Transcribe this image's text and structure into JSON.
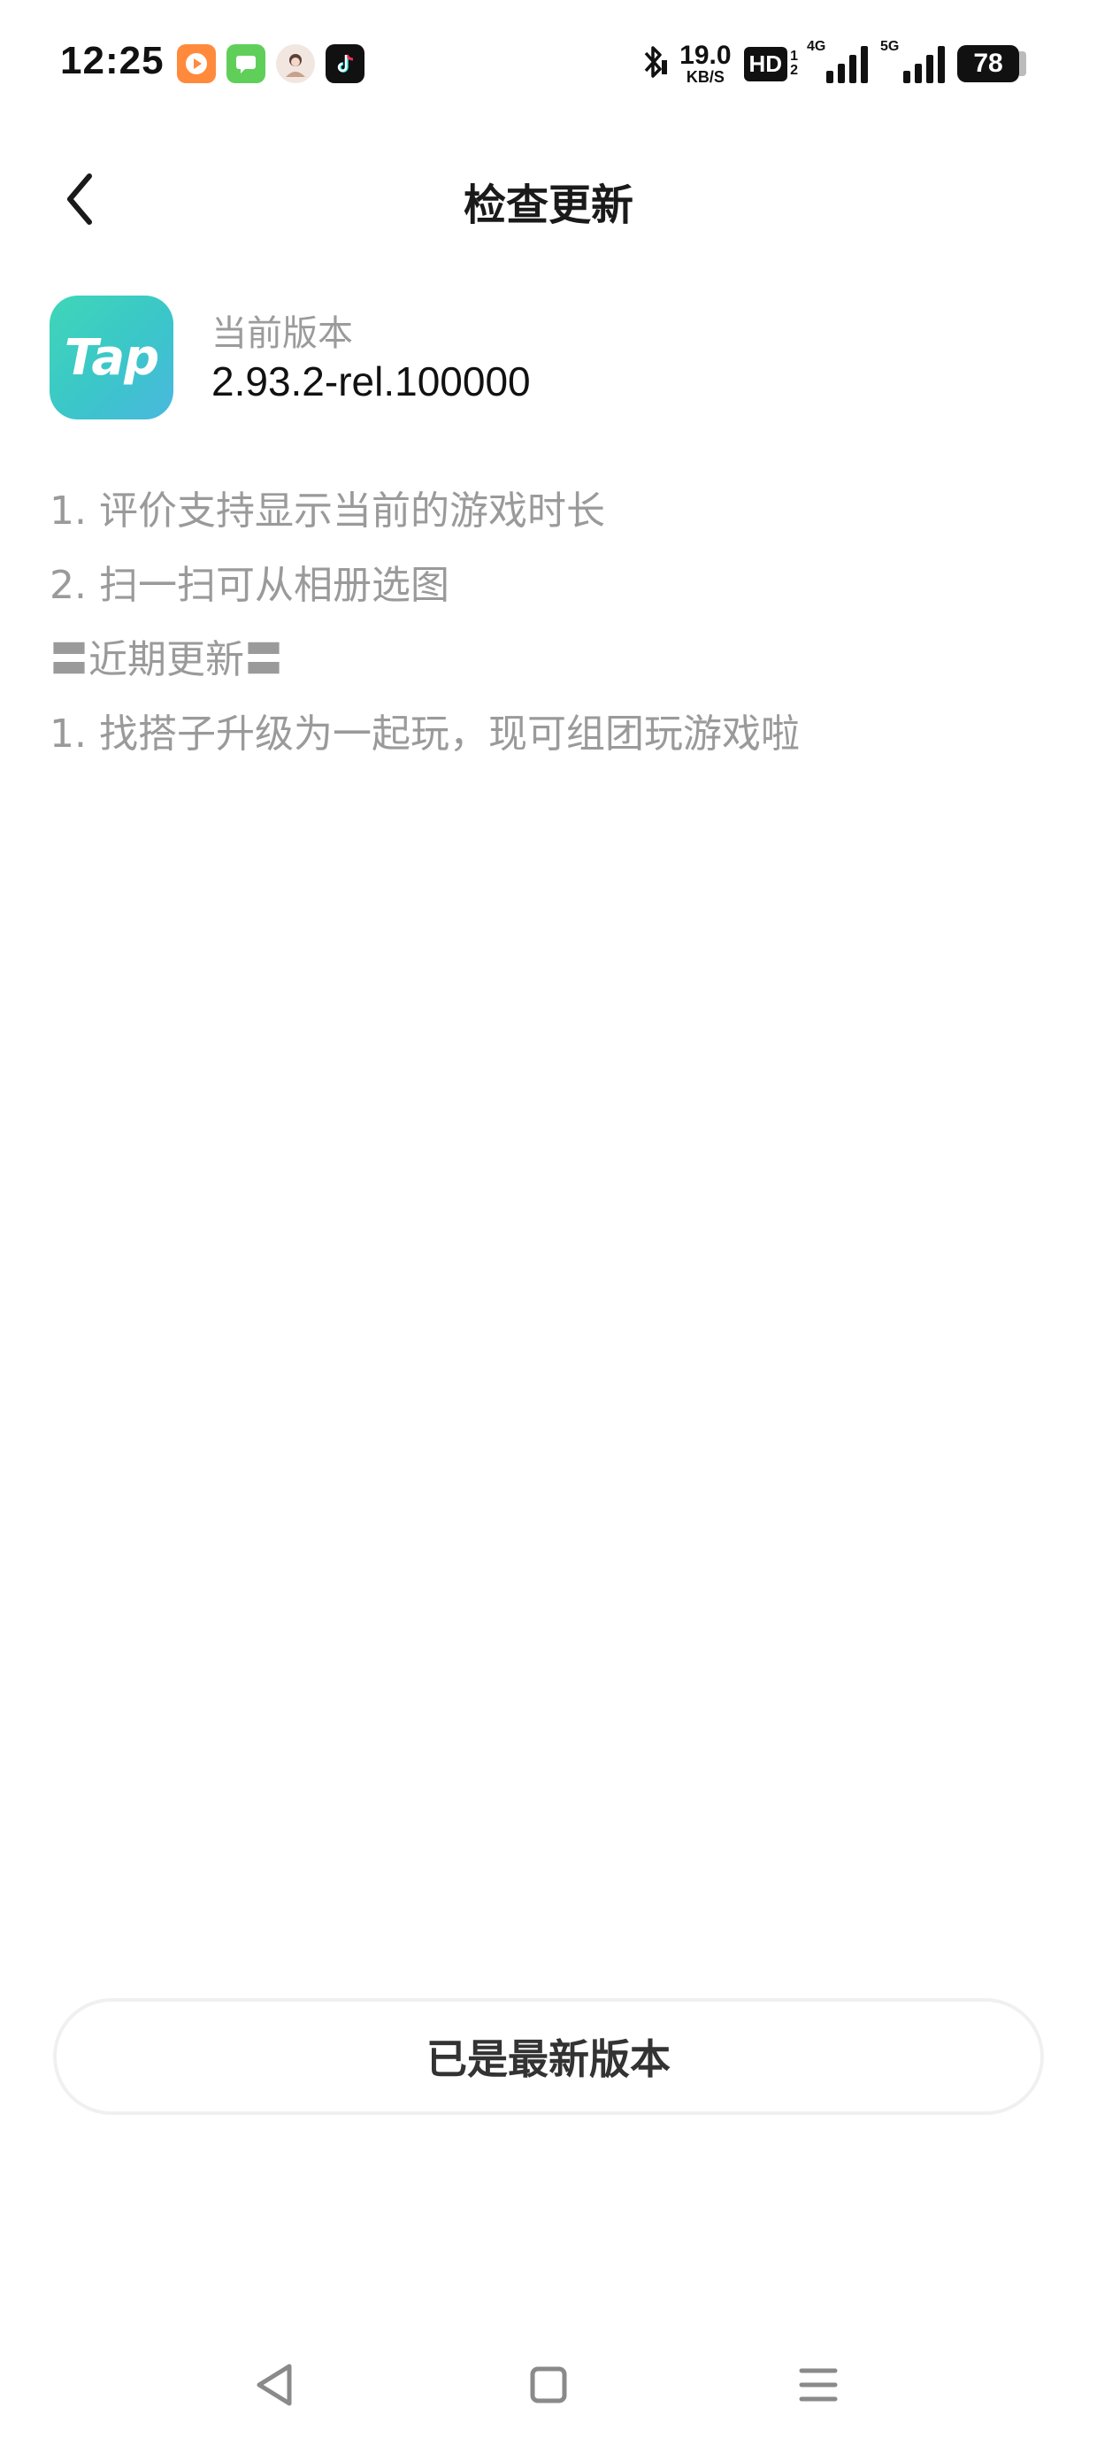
{
  "status_bar": {
    "time": "12:25",
    "notification_icons": [
      "video-app-icon",
      "message-app-icon",
      "avatar-app-icon",
      "tiktok-icon"
    ],
    "net_speed_value": "19.0",
    "net_speed_unit": "KB/S",
    "hd_label": "HD",
    "hd_sub_top": "1",
    "hd_sub_bottom": "2",
    "signal_1_label": "4G",
    "signal_2_label": "5G",
    "battery_level": "78"
  },
  "header": {
    "title": "检查更新",
    "back_icon": "chevron-left-icon"
  },
  "app_info": {
    "logo_text": "Tap",
    "version_label": "当前版本",
    "version_value": "2.93.2-rel.100000"
  },
  "changelog": {
    "lines": [
      "1. 评价支持显示当前的游戏时长",
      "2. 扫一扫可从相册选图",
      "〓近期更新〓",
      "1. 找搭子升级为一起玩，现可组团玩游戏啦"
    ]
  },
  "actions": {
    "latest_label": "已是最新版本"
  },
  "colors": {
    "logo_gradient_start": "#3fd6b8",
    "logo_gradient_end": "#4ab8df",
    "muted_text": "#9a9a9a",
    "title_text": "#1a1a1a"
  },
  "nav_bar": {
    "icons": [
      "back-triangle-icon",
      "home-square-icon",
      "menu-lines-icon"
    ]
  }
}
